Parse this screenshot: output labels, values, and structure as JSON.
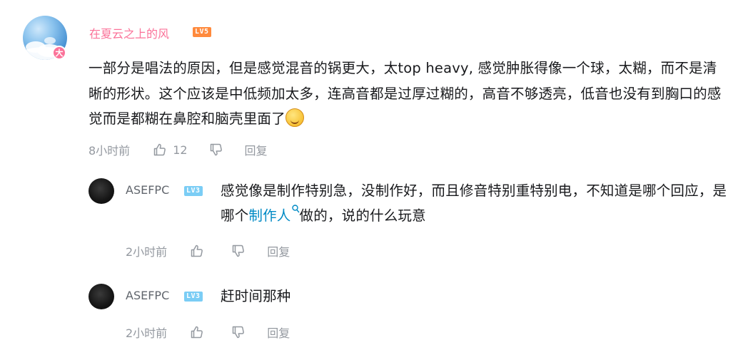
{
  "main_comment": {
    "username": "在夏云之上的风",
    "level": "LV5",
    "avatar_badge": "大",
    "text": "一部分是唱法的原因，但是感觉混音的锅更大，太top heavy, 感觉肿胀得像一个球，太糊，而不是清晰的形状。这个应该是中低频加太多，连高音都是过厚过糊的，高音不够透亮，低音也没有到胸口的感觉而是都糊在鼻腔和脑壳里面了",
    "emoji_icon": "laughing-face-emoji",
    "time": "8小时前",
    "like_count": "12",
    "reply_label": "回复"
  },
  "replies": [
    {
      "username": "ASEFPC",
      "level": "LV3",
      "text_before_link": "感觉像是制作特别急，没制作好，而且修音特别重特别电，不知道是哪个回应，是哪个",
      "link_text": "制作人",
      "text_after_link": "做的，说的什么玩意",
      "time": "2小时前",
      "reply_label": "回复"
    },
    {
      "username": "ASEFPC",
      "level": "LV3",
      "text": "赶时间那种",
      "time": "2小时前",
      "reply_label": "回复"
    }
  ],
  "colors": {
    "username_vip": "#fb7299",
    "meta_gray": "#9499a0",
    "link_blue": "#008ac5",
    "lv5_orange": "#ff8a3d",
    "lv3_blue": "#7bcdf5"
  }
}
